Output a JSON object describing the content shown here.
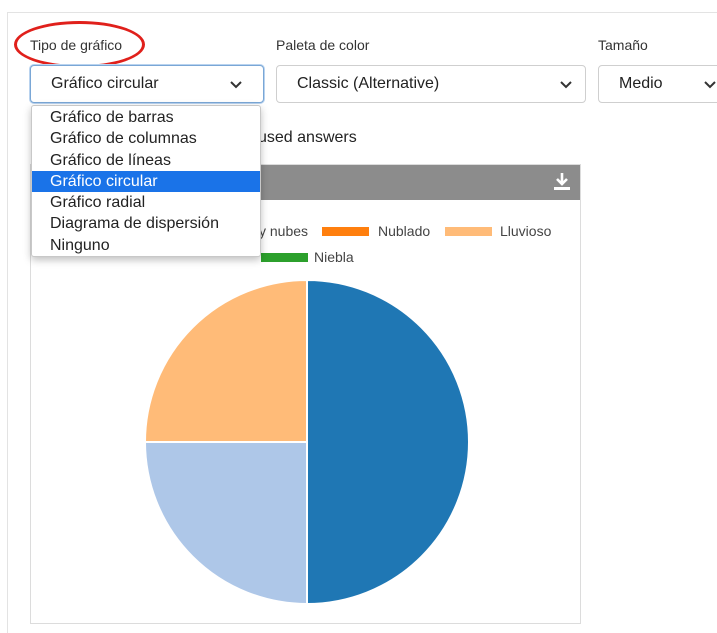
{
  "fields": {
    "chart_type": {
      "label": "Tipo de gráfico",
      "value": "Gráfico circular",
      "options": [
        "Gráfico de barras",
        "Gráfico de columnas",
        "Gráfico de líneas",
        "Gráfico circular",
        "Gráfico radial",
        "Diagrama de dispersión",
        "Ninguno"
      ],
      "selected_index": 3
    },
    "palette": {
      "label": "Paleta de color",
      "value": "Classic (Alternative)"
    },
    "size": {
      "label": "Tamaño",
      "value": "Medio"
    }
  },
  "behind_text": "used answers",
  "chart": {
    "legend": [
      {
        "label": "y nubes",
        "color": null
      },
      {
        "label": "Nublado",
        "color": "#ff7f0e"
      },
      {
        "label": "Lluvioso",
        "color": "#ffbb78"
      },
      {
        "label": "Niebla",
        "color": "#2ca02c"
      }
    ],
    "download_icon": "download-icon"
  },
  "chart_data": {
    "type": "pie",
    "slices": [
      {
        "value": 50,
        "color": "#1f77b4"
      },
      {
        "value": 25,
        "color": "#aec7e8"
      },
      {
        "value": 25,
        "color": "#ffbb78"
      }
    ]
  },
  "colors": {
    "accent": "#1a73e8",
    "annotation": "#e0201b",
    "chart_header": "#8c8c8c"
  }
}
